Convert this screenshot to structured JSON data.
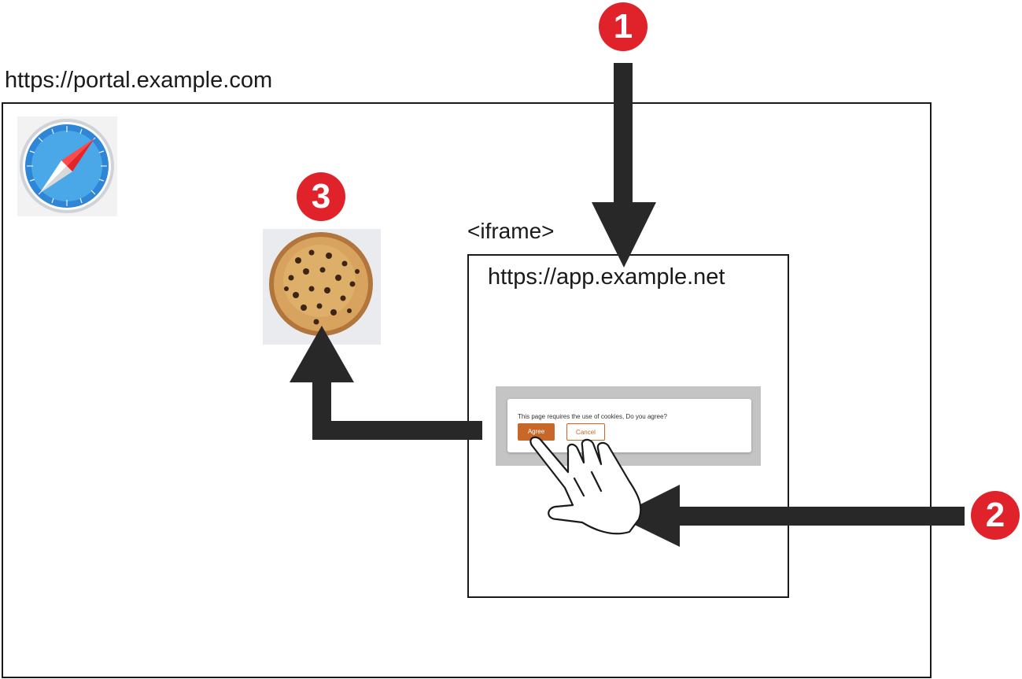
{
  "outer": {
    "url": "https://portal.example.com"
  },
  "iframe": {
    "tag": "<iframe>",
    "url": "https://app.example.net"
  },
  "dialog": {
    "message": "This page requires the use of cookies, Do you agree?",
    "agree_label": "Agree",
    "cancel_label": "Cancel",
    "accent_color": "#c8672a"
  },
  "steps": {
    "one": "1",
    "two": "2",
    "three": "3"
  },
  "icons": {
    "browser": "safari-compass-icon",
    "cookie": "cookie-icon",
    "hand": "pointing-hand-icon"
  },
  "colors": {
    "badge": "#e0222b",
    "arrow": "#282828"
  }
}
